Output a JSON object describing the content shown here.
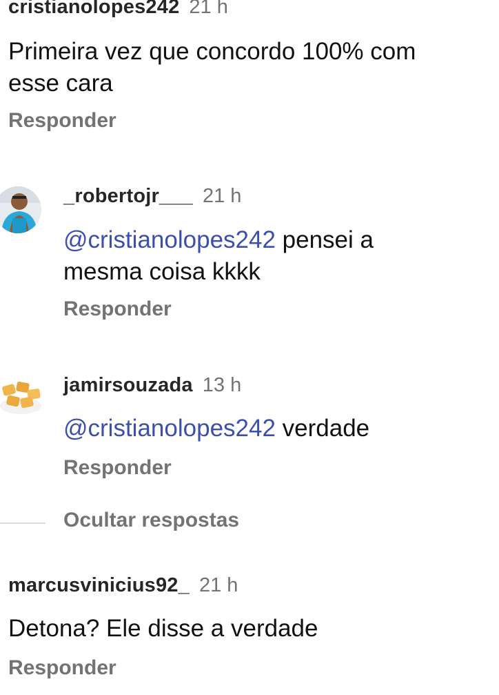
{
  "comments": [
    {
      "username": "cristianolopes242",
      "time": "21 h",
      "text_line1": "Primeira vez que concordo 100% com",
      "text_line2": "esse cara",
      "reply_label": "Responder"
    },
    {
      "username": "_robertojr___",
      "time": "21 h",
      "mention": "@cristianolopes242",
      "text_rest": " pensei a",
      "text_line2": "mesma coisa kkkk",
      "reply_label": "Responder",
      "avatar_icon": "person-avatar"
    },
    {
      "username": "jamirsouzada",
      "time": "13 h",
      "mention": "@cristianolopes242",
      "text_rest": " verdade",
      "reply_label": "Responder",
      "avatar_icon": "pastel-food-avatar"
    },
    {
      "username": "marcusvinicius92_",
      "time": "21 h",
      "text_line1": "Detona? Ele disse a verdade",
      "reply_label": "Responder"
    }
  ],
  "hide_replies_label": "Ocultar respostas",
  "colors": {
    "mention": "#3b4fae",
    "secondary_text": "#737373"
  }
}
